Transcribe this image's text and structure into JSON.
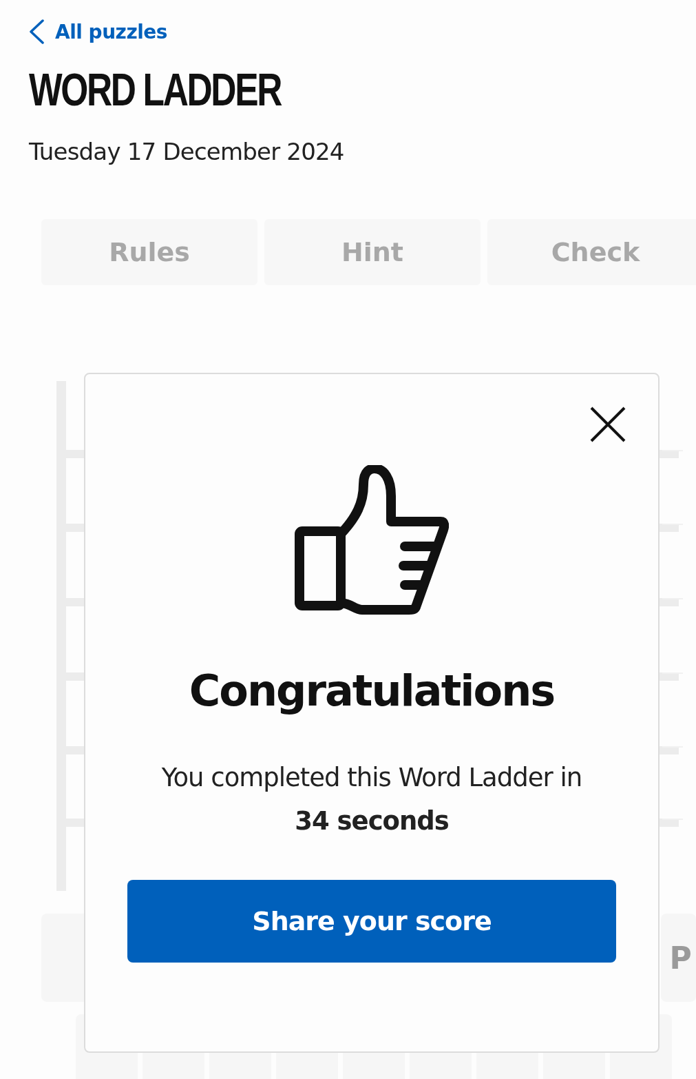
{
  "back_link": {
    "label": "All puzzles"
  },
  "title": "WORD LADDER",
  "date": "Tuesday 17 December 2024",
  "toolbar": [
    {
      "label": "Rules"
    },
    {
      "label": "Hint"
    },
    {
      "label": "Check"
    }
  ],
  "keyboard": {
    "keys": [
      "P"
    ]
  },
  "dialog": {
    "title": "Congratulations",
    "message": "You completed this Word Ladder in **34 seconds**",
    "button": "Share your score"
  }
}
